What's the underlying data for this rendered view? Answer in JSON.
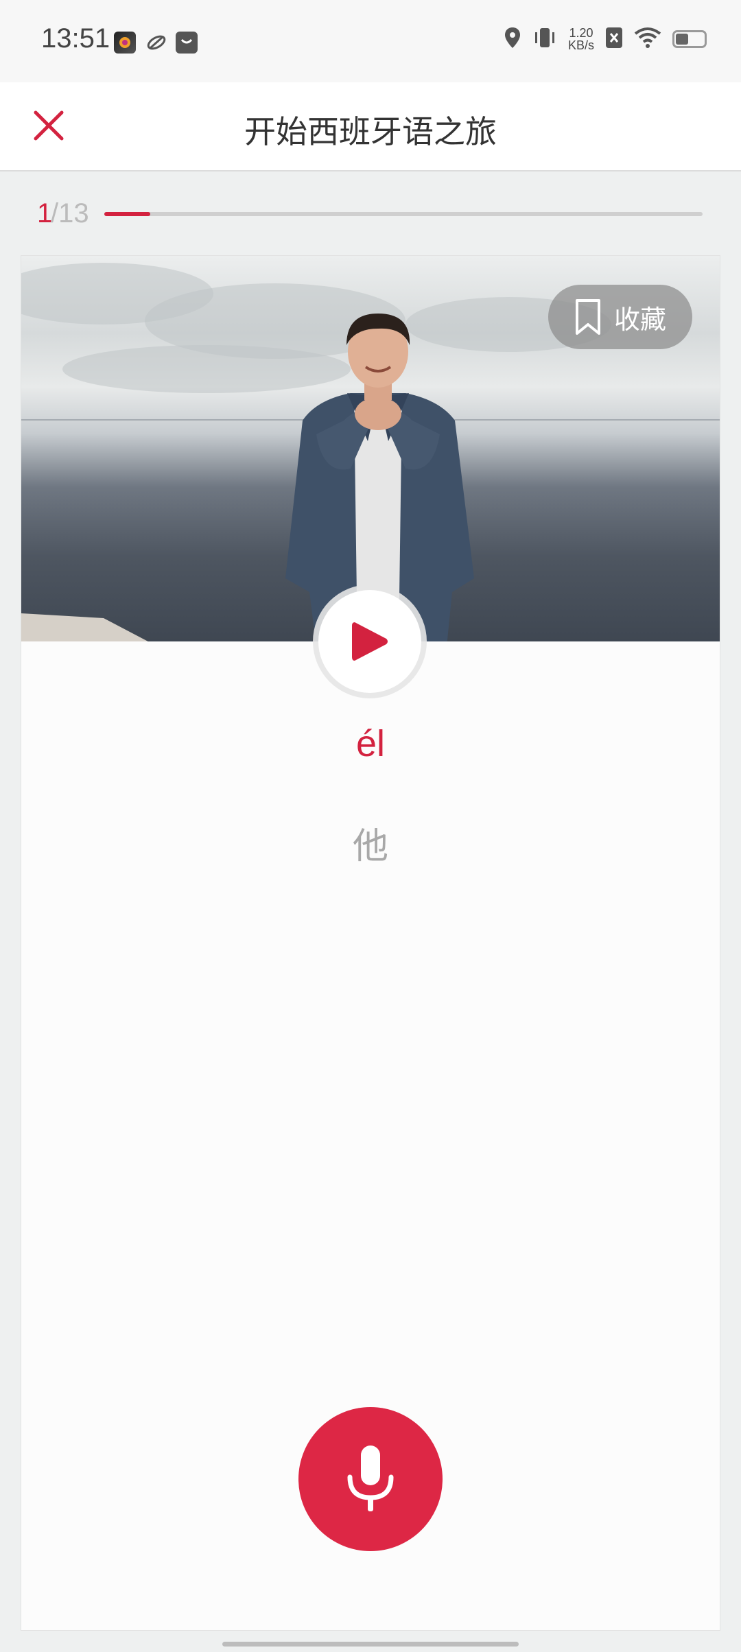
{
  "status_bar": {
    "time": "13:51",
    "speed_value": "1.20",
    "speed_unit": "KB/s",
    "battery_level": 0.45,
    "icons": [
      "app-icon",
      "link-icon",
      "bag-icon",
      "location-icon",
      "vibrate-icon",
      "data-speed",
      "sim-off-icon",
      "wifi-icon",
      "battery-icon"
    ]
  },
  "header": {
    "title": "开始西班牙语之旅",
    "close_icon": "close-icon"
  },
  "progress": {
    "current": "1",
    "total": "/13",
    "fraction": 0.0769
  },
  "card": {
    "bookmark_label": "收藏",
    "word": "él",
    "translation": "他",
    "play_icon": "play-icon",
    "mic_icon": "microphone-icon"
  },
  "colors": {
    "accent": "#d3223f",
    "mic": "#dd2745",
    "muted": "#a8a8a8"
  }
}
